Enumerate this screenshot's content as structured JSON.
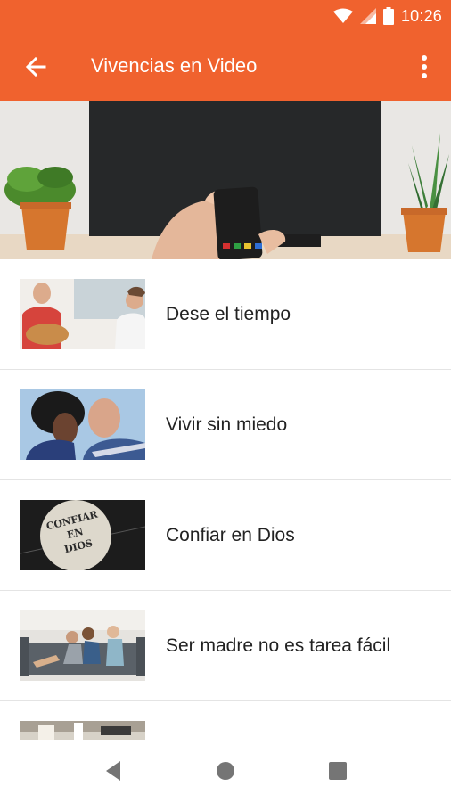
{
  "status": {
    "time": "10:26",
    "icons": [
      "wifi-icon",
      "signal-icon",
      "battery-icon"
    ]
  },
  "appbar": {
    "title": "Vivencias en Video",
    "back_icon": "arrow-back-icon",
    "menu_icon": "more-vert-icon",
    "color": "#f0622e"
  },
  "videos": [
    {
      "title": "Dese el tiempo"
    },
    {
      "title": "Vivir sin miedo"
    },
    {
      "title": "Confiar en Dios",
      "thumb_text": [
        "CONFIAR",
        "EN",
        "DIOS"
      ]
    },
    {
      "title": "Ser madre no es tarea fácil"
    },
    {
      "title": ""
    }
  ],
  "navbar": {
    "icons": [
      "back-triangle-icon",
      "home-circle-icon",
      "recents-square-icon"
    ]
  }
}
